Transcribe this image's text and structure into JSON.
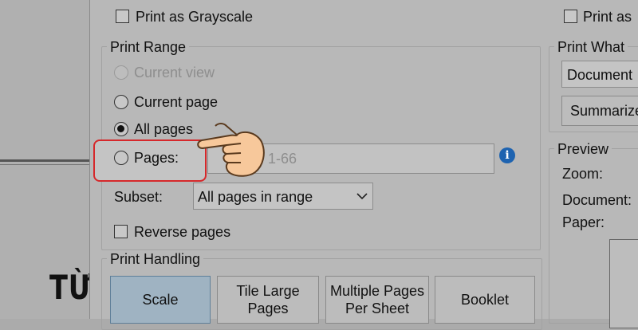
{
  "background_page": {
    "text": "TỪ V"
  },
  "top_options": {
    "grayscale_label": "Print as Grayscale",
    "print_as_label": "Print as"
  },
  "print_range": {
    "legend": "Print Range",
    "current_view": "Current view",
    "current_page": "Current page",
    "all_pages": "All pages",
    "pages": "Pages:",
    "pages_placeholder": "1-66",
    "subset_label": "Subset:",
    "subset_value": "All pages in range",
    "reverse_pages": "Reverse pages",
    "selected": "all_pages"
  },
  "print_what": {
    "legend": "Print What",
    "document_value": "Document",
    "summarize_label": "Summarize"
  },
  "preview": {
    "legend": "Preview",
    "zoom_label": "Zoom:",
    "document_label": "Document:",
    "paper_label": "Paper:"
  },
  "print_handling": {
    "legend": "Print Handling",
    "tabs": [
      "Scale",
      "Tile Large\nPages",
      "Multiple Pages\nPer Sheet",
      "Booklet"
    ],
    "active_tab": "Scale"
  },
  "colors": {
    "highlight": "#d6282b",
    "info_icon": "#1e63b0",
    "hand_fill": "#f7c89b"
  }
}
